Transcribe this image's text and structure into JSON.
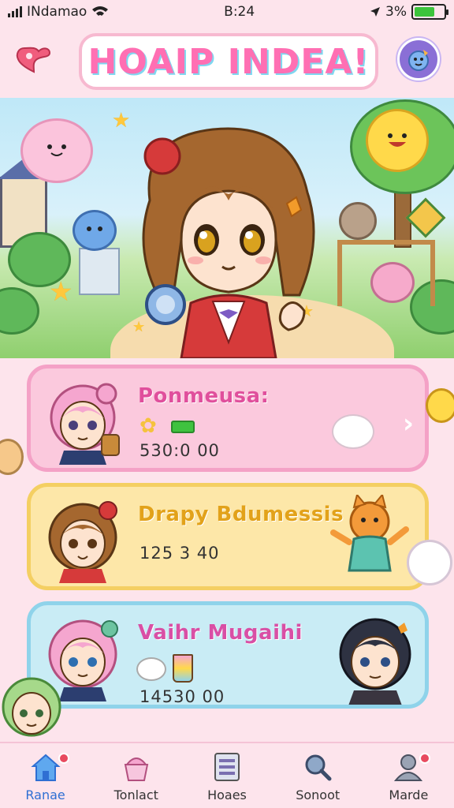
{
  "status_bar": {
    "carrier": "INdamao",
    "time": "B:24",
    "battery_percent": "3%",
    "battery_level": 0.7,
    "signal_icon": "signal-bars-icon",
    "wifi_icon": "wifi-icon"
  },
  "header": {
    "title": "HOAIP INDEA!",
    "back_icon": "back-heart-icon",
    "profile_icon": "avatar-pet-icon"
  },
  "cards": [
    {
      "name": "Ponmeusa:",
      "score": "530:0  00",
      "color": "#fbc9dd"
    },
    {
      "name": "Drapy Bdumessis",
      "score": "125 3  40",
      "color": "#fde7a8"
    },
    {
      "name": "Vaihr Mugaihi",
      "score": "14530  00",
      "color": "#c9ecf5"
    }
  ],
  "tabs": [
    {
      "label": "Ranae",
      "icon": "home-icon",
      "active": true
    },
    {
      "label": "Tonlact",
      "icon": "cupcake-icon",
      "active": false
    },
    {
      "label": "Hoaes",
      "icon": "list-icon",
      "active": false
    },
    {
      "label": "Sonoot",
      "icon": "search-icon",
      "active": false
    },
    {
      "label": "Marde",
      "icon": "profile-icon",
      "active": false
    }
  ],
  "colors": {
    "accent": "#2f6fd3",
    "background": "#fde4ec",
    "badge": "#e84a5f"
  }
}
